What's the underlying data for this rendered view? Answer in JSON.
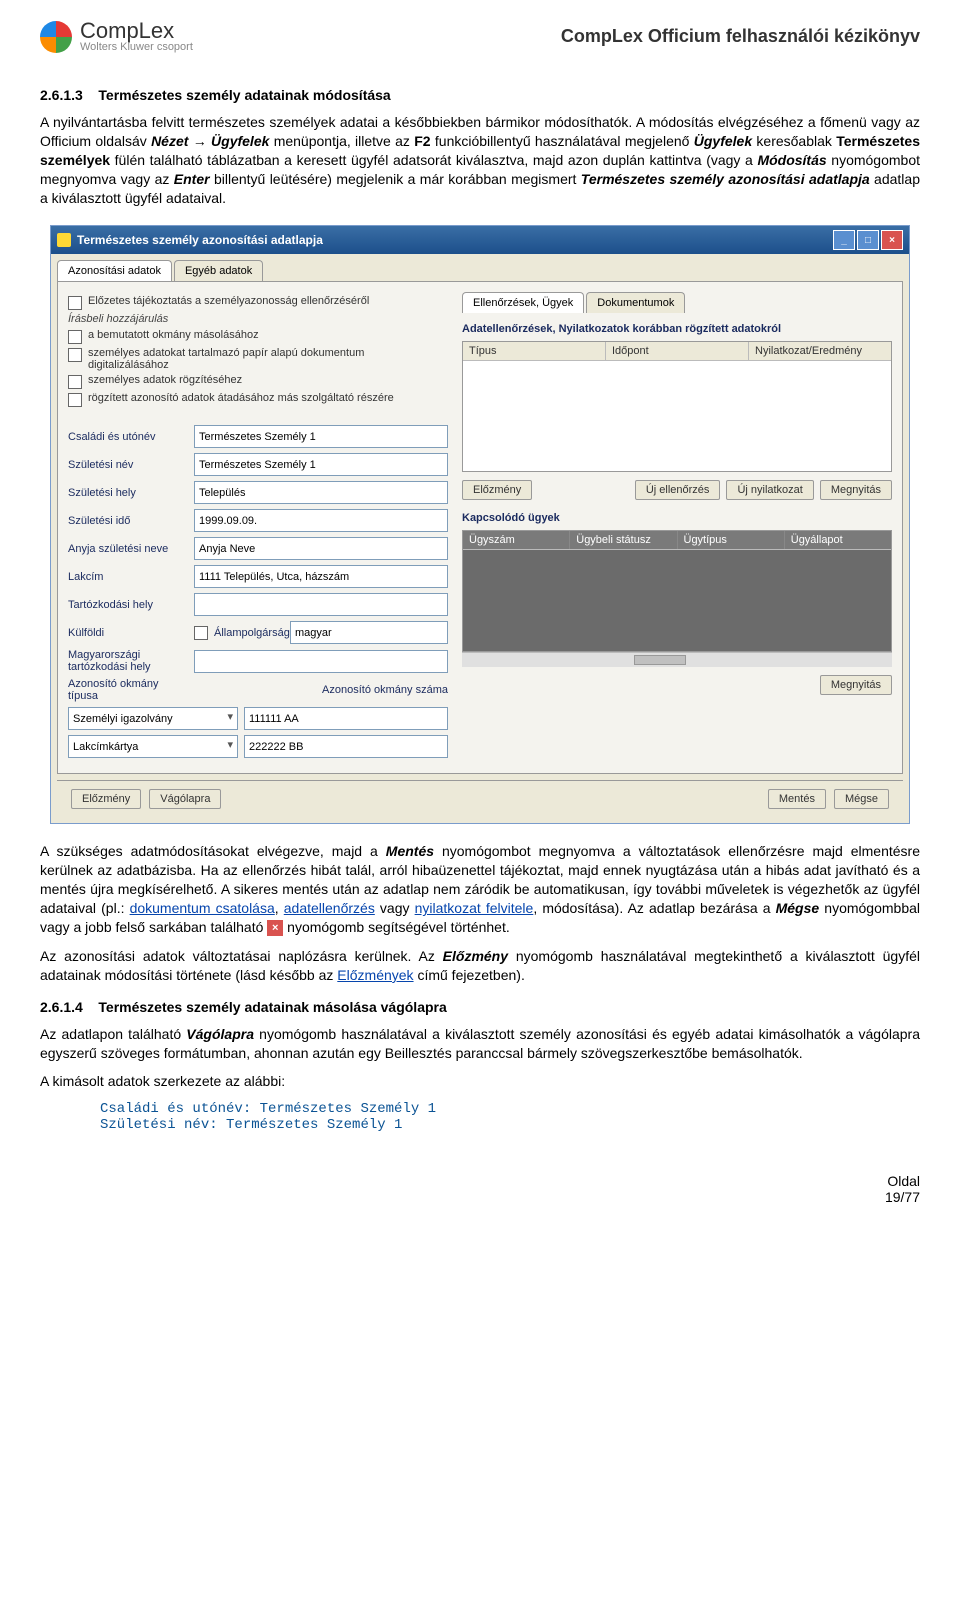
{
  "header": {
    "brand": "CompLex",
    "sub": "Wolters Kluwer csoport",
    "doc_title": "CompLex Officium felhasználói kézikönyv"
  },
  "sec1": {
    "num": "2.6.1.3",
    "title": "Természetes személy adatainak módosítása"
  },
  "para1_a": "A nyilvántartásba felvitt természetes személyek adatai a későbbiekben bármikor módosíthatók. A módosítás elvégzéséhez a főmenü vagy az Officium oldalsáv ",
  "para1_b": "Nézet",
  "para1_c": " → ",
  "para1_d": "Ügyfelek",
  "para1_e": " menüpontja, illetve az ",
  "para1_f": "F2",
  "para1_g": " funkcióbillentyű használatával megjelenő ",
  "para1_h": "Ügyfelek",
  "para1_i": " keresőablak ",
  "para1_j": "Természetes személyek",
  "para1_k": " fülén található táblázatban a keresett ügyfél adatsorát kiválasztva, majd azon duplán kattintva (vagy a ",
  "para1_l": "Módosítás",
  "para1_m": " nyomógombot megnyomva vagy az ",
  "para1_n": "Enter",
  "para1_o": " billentyű leütésére) megjelenik a már korábban megismert ",
  "para1_p": "Természetes személy azonosítási adatlapja",
  "para1_q": " adatlap a kiválasztott ügyfél adataival.",
  "win": {
    "title": "Természetes személy azonosítási adatlapja",
    "tabs": {
      "t1": "Azonosítási adatok",
      "t2": "Egyéb adatok"
    },
    "chk_head": "Előzetes tájékoztatás a személyazonosság ellenőrzéséről",
    "chk_note": "Írásbeli hozzájárulás",
    "chk1": "a bemutatott okmány másolásához",
    "chk2": "személyes adatokat tartalmazó papír alapú dokumentum digitalizálásához",
    "chk3": "személyes adatok rögzítéséhez",
    "chk4": "rögzített azonosító adatok átadásához más szolgáltató részére",
    "labels": {
      "csaladi": "Családi és utónév",
      "szulnev": "Születési név",
      "szulhely": "Születési hely",
      "szulido": "Születési idő",
      "anyja": "Anyja születési neve",
      "lakcim": "Lakcím",
      "tartozkodasi": "Tartózkodási hely",
      "kulfoldi": "Külföldi",
      "allampolg": "Állampolgárság",
      "magyar_tart": "Magyarországi tartózkodási hely",
      "okm_tipus": "Azonosító okmány típusa",
      "okm_szam": "Azonosító okmány száma"
    },
    "values": {
      "csaladi": "Természetes Személy 1",
      "szulnev": "Természetes Személy 1",
      "szulhely": "Település",
      "szulido": "1999.09.09.",
      "anyja": "Anyja Neve",
      "lakcim": "1111 Település, Utca, házszám",
      "allampolg": "magyar",
      "okm_tipus": "Személyi igazolvány",
      "okm_szam": "111111 AA",
      "lakcimk": "Lakcímkártya",
      "lakcimk_szam": "222222 BB"
    },
    "right_tabs": {
      "r1": "Ellenőrzések, Ügyek",
      "r2": "Dokumentumok"
    },
    "right_head": "Adatellenőrzések, Nyilatkozatok korábban rögzített adatokról",
    "cols1": {
      "c1": "Típus",
      "c2": "Időpont",
      "c3": "Nyilatkozat/Eredmény"
    },
    "btns1": {
      "elozmeny": "Előzmény",
      "ujell": "Új ellenőrzés",
      "ujnyil": "Új nyilatkozat",
      "megny": "Megnyitás"
    },
    "kapcs_head": "Kapcsolódó ügyek",
    "cols2": {
      "c1": "Ügyszám",
      "c2": "Ügybeli státusz",
      "c3": "Ügytípus",
      "c4": "Ügyállapot"
    },
    "megnyitas": "Megnyitás",
    "bottom": {
      "elozmeny": "Előzmény",
      "vagolapra": "Vágólapra",
      "mentes": "Mentés",
      "megse": "Mégse"
    }
  },
  "para2_a": "A szükséges adatmódosításokat elvégezve, majd a ",
  "para2_b": "Mentés",
  "para2_c": " nyomógombot megnyomva a változtatások ellenőrzésre majd elmentésre kerülnek az adatbázisba. Ha az ellenőrzés hibát talál, arról hibaüzenettel tájékoztat, majd ennek nyugtázása után a hibás adat javítható és a mentés újra megkísérelhető. A sikeres mentés után az adatlap nem záródik be automatikusan, így további műveletek is végezhetők az ügyfél adataival (pl.: ",
  "para2_link1": "dokumentum csatolása",
  "para2_d": ", ",
  "para2_link2": "adatellenőrzés",
  "para2_e": " vagy ",
  "para2_link3": "nyilatkozat felvitele",
  "para2_f": ", módosítása). Az adatlap bezárása a ",
  "para2_g": "Mégse",
  "para2_h": " nyomógombbal vagy a jobb felső sarkában található ",
  "para2_i": " nyomógomb segítségével történhet.",
  "para3_a": "Az azonosítási adatok változtatásai naplózásra kerülnek. Az ",
  "para3_b": "Előzmény",
  "para3_c": " nyomógomb használatával megtekinthető a kiválasztott ügyfél adatainak módosítási története (lásd később az ",
  "para3_link": "Előzmények",
  "para3_d": " című fejezetben).",
  "sec2": {
    "num": "2.6.1.4",
    "title": "Természetes személy adatainak másolása vágólapra"
  },
  "para4_a": "Az adatlapon található ",
  "para4_b": "Vágólapra",
  "para4_c": " nyomógomb használatával a kiválasztott személy azonosítási és egyéb adatai kimásolhatók a vágólapra egyszerű szöveges formátumban, ahonnan azután egy Beillesztés paranccsal bármely szövegszerkesztőbe bemásolhatók.",
  "para5": "A kimásolt adatok szerkezete az alábbi:",
  "mono1": "Családi és utónév: Természetes Személy 1",
  "mono2": "Születési név: Természetes Személy 1",
  "footer": {
    "label": "Oldal",
    "page": "19/77"
  }
}
